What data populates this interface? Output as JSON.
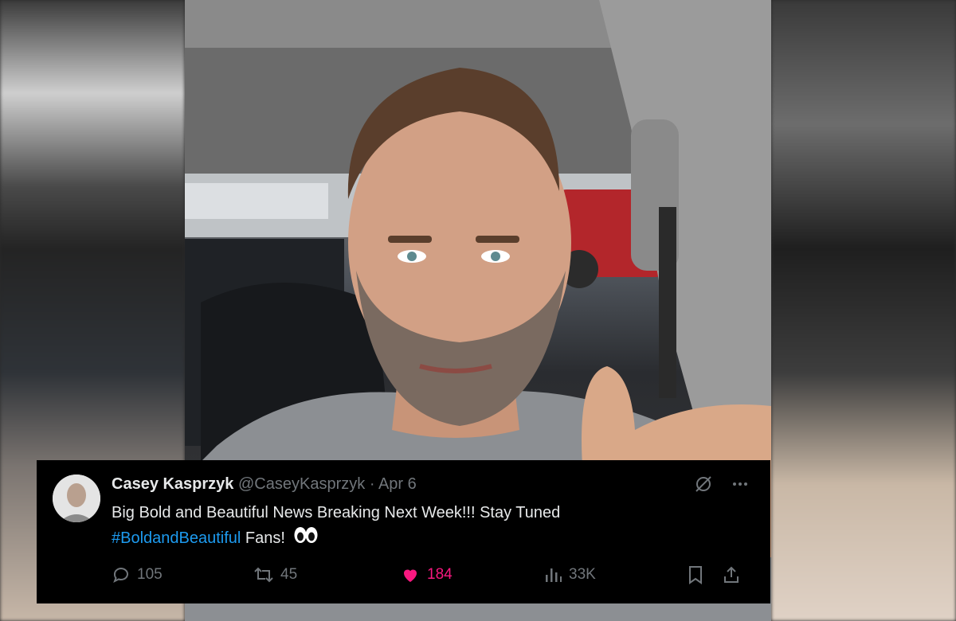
{
  "tweet": {
    "author_name": "Casey Kasprzyk",
    "handle": "@CaseyKasprzyk",
    "separator": "·",
    "date": "Apr 6",
    "text_main": "Big Bold and Beautiful News Breaking Next Week!!! Stay Tuned",
    "hashtag": "#BoldandBeautiful",
    "text_after_hashtag": "Fans!",
    "emoji": "eyes",
    "stats": {
      "replies": "105",
      "reposts": "45",
      "likes": "184",
      "views": "33K"
    },
    "liked": true
  },
  "colors": {
    "background": "#000000",
    "text": "#e7e9ea",
    "muted": "#71767b",
    "link": "#1d9bf0",
    "like": "#f91880"
  },
  "icons": [
    "grok-icon",
    "more-icon",
    "reply-icon",
    "repost-icon",
    "heart-icon",
    "views-icon",
    "bookmark-icon",
    "share-icon"
  ]
}
